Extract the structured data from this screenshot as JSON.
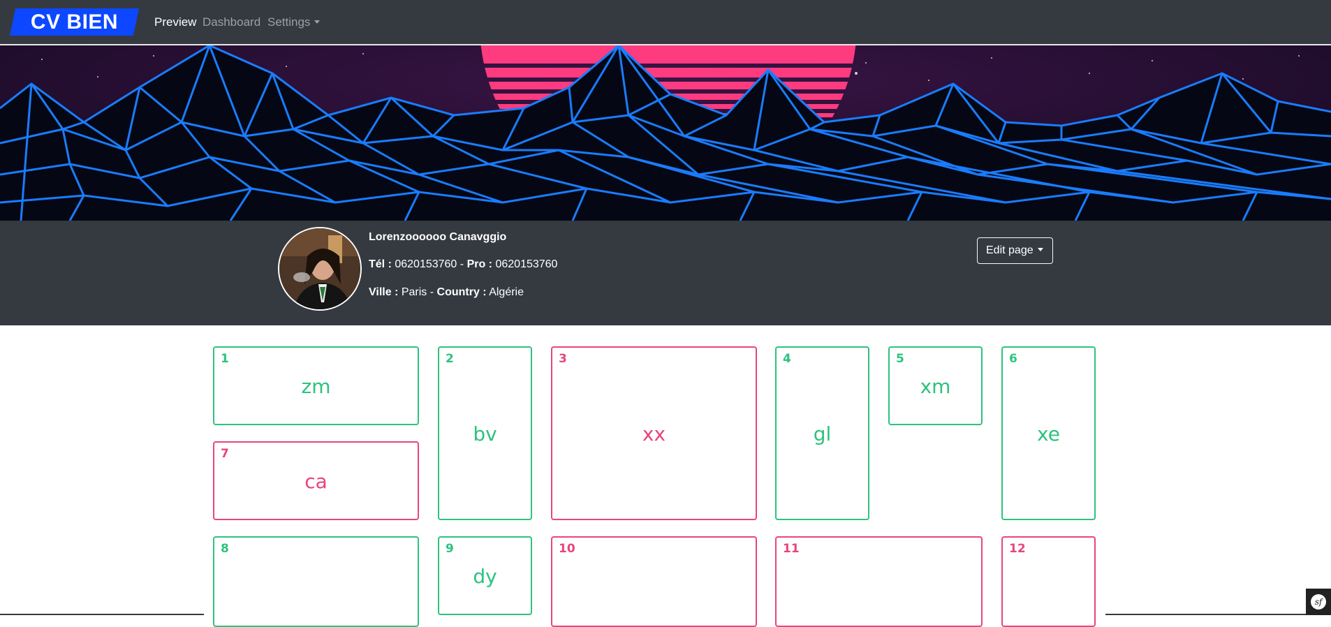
{
  "navbar": {
    "brand": "CV BIEN",
    "items": [
      {
        "label": "Preview",
        "active": true
      },
      {
        "label": "Dashboard",
        "active": false
      },
      {
        "label": "Settings",
        "active": false
      }
    ]
  },
  "profile": {
    "name": "Lorenzoooooo Canavggio",
    "tel_label": "Tél :",
    "tel": "0620153760",
    "pro_label": "Pro :",
    "pro": "0620153760",
    "ville_label": "Ville :",
    "ville": "Paris",
    "country_label": "Country :",
    "country": "Algérie",
    "separator": "-",
    "edit_button": "Edit page"
  },
  "cards": [
    {
      "num": "1",
      "code": "zm",
      "color": "green"
    },
    {
      "num": "2",
      "code": "bv",
      "color": "green"
    },
    {
      "num": "3",
      "code": "xx",
      "color": "red"
    },
    {
      "num": "4",
      "code": "gl",
      "color": "green"
    },
    {
      "num": "5",
      "code": "xm",
      "color": "green"
    },
    {
      "num": "6",
      "code": "xe",
      "color": "green"
    },
    {
      "num": "7",
      "code": "ca",
      "color": "red"
    },
    {
      "num": "8",
      "code": "",
      "color": "green"
    },
    {
      "num": "9",
      "code": "dy",
      "color": "green"
    },
    {
      "num": "10",
      "code": "",
      "color": "red"
    },
    {
      "num": "11",
      "code": "",
      "color": "red"
    },
    {
      "num": "12",
      "code": "",
      "color": "red"
    }
  ],
  "colors": {
    "navbar_bg": "#343a40",
    "brand_bg": "#0d47ff",
    "green": "#2ec27e",
    "red": "#e8457a"
  },
  "icons": {
    "settings_caret": "chevron-down-icon",
    "edit_caret": "chevron-down-icon",
    "footer_badge": "symfony-icon"
  }
}
